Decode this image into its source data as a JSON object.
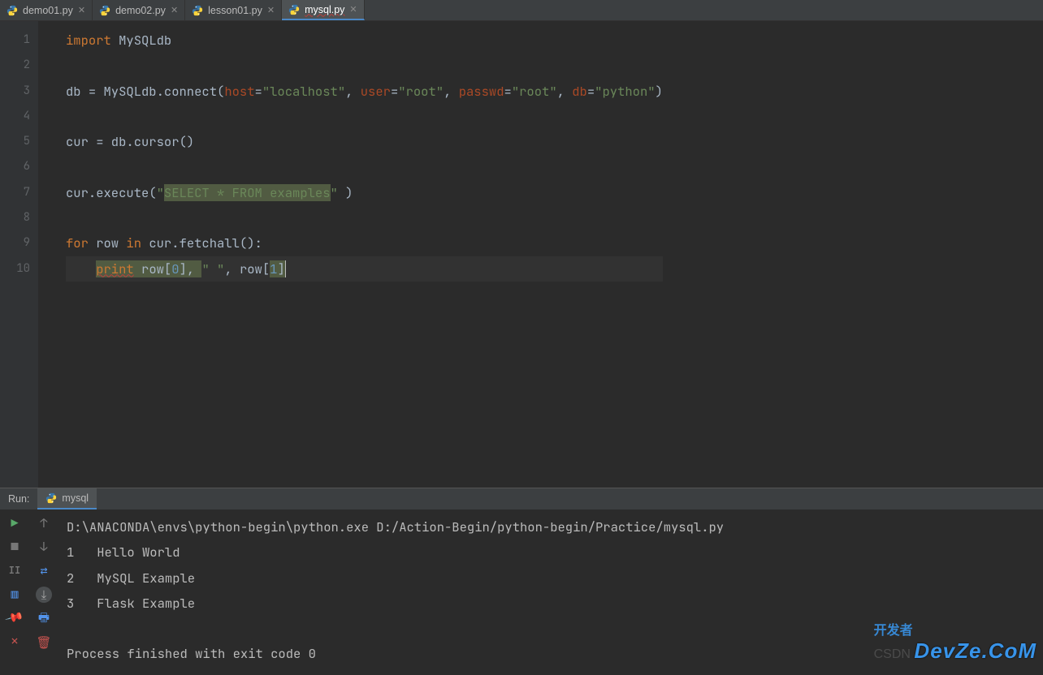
{
  "tabs": [
    {
      "label": "demo01.py",
      "active": false
    },
    {
      "label": "demo02.py",
      "active": false
    },
    {
      "label": "lesson01.py",
      "active": false
    },
    {
      "label": "mysql.py",
      "active": true
    }
  ],
  "gutter": [
    "1",
    "2",
    "3",
    "4",
    "5",
    "6",
    "7",
    "8",
    "9",
    "10"
  ],
  "code": {
    "l1_kw": "import",
    "l1_mod": "MySQLdb",
    "l3_a": "db = MySQLdb.connect(",
    "l3_host": "host",
    "l3_eq": "=",
    "l3_host_v": "\"localhost\"",
    "l3_user": "user",
    "l3_user_v": "\"root\"",
    "l3_passwd": "passwd",
    "l3_passwd_v": "\"root\"",
    "l3_db": "db",
    "l3_db_v": "\"python\"",
    "l3_close": ")",
    "l5": "cur = db.cursor()",
    "l7_a": "cur.execute(",
    "l7_s1": "\"",
    "l7_hl": "SELECT * FROM examples",
    "l7_s2": "\"",
    "l7_b": " )",
    "l9_for": "for",
    "l9_a": " row ",
    "l9_in": "in",
    "l9_b": " cur.fetchall():",
    "l10_indent": "    ",
    "l10_print": "print",
    "l10_a": " row[",
    "l10_n0": "0",
    "l10_b": "], ",
    "l10_s": "\" \"",
    "l10_c": ", row[",
    "l10_n1": "1",
    "l10_d": "]"
  },
  "run": {
    "label": "Run:",
    "tab": "mysql",
    "cmd": "D:\\ANACONDA\\envs\\python-begin\\python.exe D:/Action-Begin/python-begin/Practice/mysql.py",
    "rows": [
      "1   Hello World",
      "2   MySQL Example",
      "3   Flask Example"
    ],
    "exit": "Process finished with exit code 0"
  },
  "watermark": {
    "cn": "开发者",
    "brand": "DevZe.CoM",
    "csdn": "CSDN"
  }
}
